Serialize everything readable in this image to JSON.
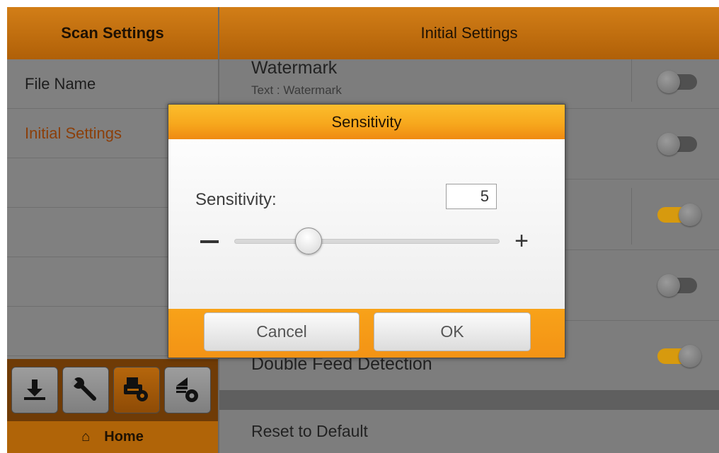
{
  "left_pane": {
    "header": "Scan Settings",
    "items": [
      {
        "label": "File Name",
        "active": false
      },
      {
        "label": "Initial Settings",
        "active": true
      }
    ],
    "toolbar_icons": [
      "download-icon",
      "wrench-icon",
      "scanner-settings-icon",
      "upload-settings-icon"
    ],
    "home_label": "Home"
  },
  "right_pane": {
    "header": "Initial Settings",
    "rows": [
      {
        "title": "Watermark",
        "subtitle": "Text : Watermark",
        "toggle": "off"
      },
      {
        "title": "",
        "subtitle": "",
        "toggle": "off"
      },
      {
        "title": "",
        "subtitle": "",
        "toggle": "on"
      },
      {
        "title": "",
        "subtitle": "",
        "toggle": "off"
      },
      {
        "title": "Double Feed Detection",
        "subtitle": "",
        "toggle": "on"
      }
    ],
    "reset_label": "Reset to Default"
  },
  "dialog": {
    "title": "Sensitivity",
    "label": "Sensitivity:",
    "value": "5",
    "slider_fraction": 0.28,
    "minus_label": "−",
    "plus_label": "+",
    "cancel_label": "Cancel",
    "ok_label": "OK"
  },
  "colors": {
    "header_orange": "#c0700f",
    "dialog_orange": "#f7a81d",
    "active_item": "#8b3f0a",
    "toggle_on": "#d79a0e"
  }
}
